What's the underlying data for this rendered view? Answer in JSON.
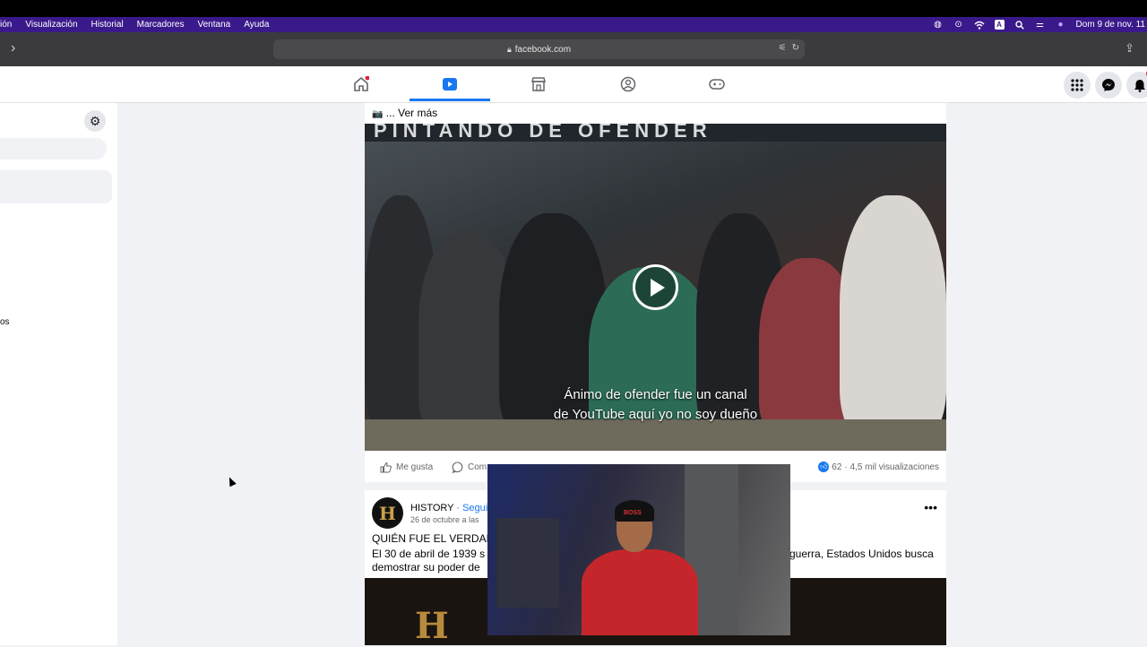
{
  "macos_menu": {
    "items": [
      "ión",
      "Visualización",
      "Historial",
      "Marcadores",
      "Ventana",
      "Ayuda"
    ],
    "clock": "Dom 9 de nov.  11",
    "input_source": "A"
  },
  "browser": {
    "url": "facebook.com",
    "back_glyph": "›"
  },
  "facebook_nav": {
    "tabs": [
      "home",
      "video",
      "marketplace",
      "groups",
      "gaming"
    ],
    "active_tab": "video"
  },
  "sidebar": {
    "partial_label": "os"
  },
  "post1": {
    "see_more": "... Ver más",
    "video_title_text": "PINTANDO DE OFENDER",
    "caption_line1": "Ánimo de ofender fue un canal",
    "caption_line2": "de YouTube aquí yo no soy dueño",
    "like_label": "Me gusta",
    "comment_label": "Com",
    "reaction_count": "62",
    "views": "· 4,5 mil visualizaciones"
  },
  "post2": {
    "page_name": "HISTORY",
    "follow_label": "· Segui",
    "date": "26 de octubre a las",
    "title": "QUIÉN FUE EL VERDAD",
    "body_left": "El 30 de abril de 1939 s",
    "body_left2": "demostrar su poder de",
    "body_right": "guerra, Estados Unidos busca",
    "logo_letter": "H",
    "image_letter": "H"
  },
  "webcam_overlay": {
    "beanie_text": "BOSS"
  },
  "colors": {
    "fb_blue": "#1877f2",
    "menubar": "#3a1a8a",
    "toolbar": "#3b3b3d"
  }
}
